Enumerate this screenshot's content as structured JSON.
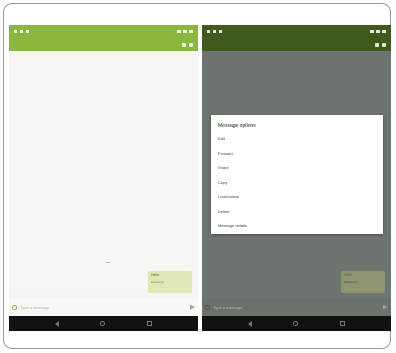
{
  "left_screen": {
    "actionbar_title": "",
    "message": {
      "text": "Hello",
      "status": "Delivered"
    },
    "input": {
      "placeholder": "Type a message",
      "value": ""
    }
  },
  "right_screen": {
    "dialog": {
      "title": "Message options",
      "items": [
        {
          "label": "Edit"
        },
        {
          "label": "Forward"
        },
        {
          "label": "Share"
        },
        {
          "label": "Copy"
        },
        {
          "label": "Lock/unlock"
        },
        {
          "label": "Delete"
        },
        {
          "label": "Message details"
        }
      ]
    },
    "message": {
      "text": "Hello",
      "status": "Delivered"
    },
    "input": {
      "placeholder": "Type a message",
      "value": ""
    }
  },
  "colors": {
    "accent_green": "#8ab83f",
    "dim_overlay": "#6e746e",
    "nav_black": "#111111"
  },
  "icons": [
    "battery-icon",
    "signal-icon",
    "wifi-icon",
    "attach-icon",
    "send-icon",
    "back-icon",
    "home-icon",
    "recents-icon"
  ]
}
